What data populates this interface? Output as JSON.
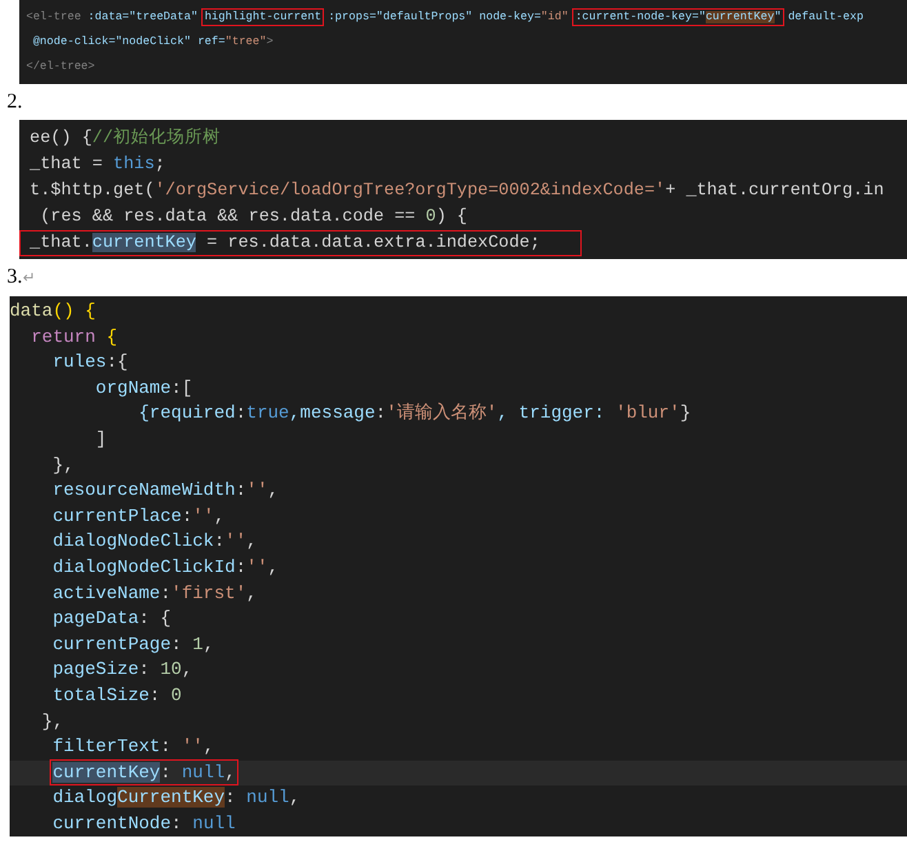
{
  "blocks": [
    {
      "lines": [
        {
          "tokens": [
            {
              "t": " <el-tree",
              "kind": "tag"
            },
            {
              "t": " :data=\"treeData\" ",
              "kind": "attr"
            },
            {
              "t": "highlight-current",
              "kind": "attr",
              "boxed": true
            },
            {
              "t": " :props=\"defaultProps\" node-key=",
              "kind": "attr"
            },
            {
              "t": "\"id\" ",
              "kind": "str"
            },
            {
              "t": ":current-node-key=\"",
              "kind": "attr",
              "boxed": true
            },
            {
              "t": "currentKey",
              "kind": "attr",
              "boxed": true,
              "match": true
            },
            {
              "t": "\"",
              "kind": "attr",
              "boxed": true
            },
            {
              "t": " default-exp",
              "kind": "attr"
            }
          ]
        },
        {
          "tokens": [
            {
              "t": "  @node-click=\"nodeClick\" ref=",
              "kind": "attr"
            },
            {
              "t": "\"tree\"",
              "kind": "str"
            },
            {
              "t": ">",
              "kind": "tag"
            }
          ]
        },
        {
          "tokens": [
            {
              "t": " </el-tree>",
              "kind": "tag"
            }
          ]
        }
      ]
    },
    {
      "label": "2.",
      "lines": [
        {
          "tokens": [
            {
              "t": " ee() {",
              "kind": "plain"
            },
            {
              "t": "//初始化场所树",
              "kind": "cmt"
            }
          ]
        },
        {
          "tokens": [
            {
              "t": " _that = ",
              "kind": "plain"
            },
            {
              "t": "this",
              "kind": "kw"
            },
            {
              "t": ";",
              "kind": "plain"
            }
          ]
        },
        {
          "tokens": [
            {
              "t": " t.$http.get(",
              "kind": "plain"
            },
            {
              "t": "'/orgService/loadOrgTree?orgType=0002&indexCode='",
              "kind": "str"
            },
            {
              "t": "+ _that.currentOrg.in",
              "kind": "plain"
            }
          ]
        },
        {
          "tokens": [
            {
              "t": "  (res && res.data && res.data.code == ",
              "kind": "plain"
            },
            {
              "t": "0",
              "kind": "num"
            },
            {
              "t": ") {",
              "kind": "plain"
            }
          ]
        },
        {
          "boxed": true,
          "tokens": [
            {
              "t": " _that.",
              "kind": "plain"
            },
            {
              "t": "currentKey",
              "kind": "prop",
              "selected": true
            },
            {
              "t": " = res.data.data.extra.indexCode;",
              "kind": "plain"
            }
          ]
        }
      ]
    },
    {
      "label": "3.",
      "mark": "↵",
      "lines": [
        {
          "tokens": [
            {
              "t": "data",
              "kind": "fn"
            },
            {
              "t": "() {",
              "kind": "punc"
            }
          ]
        },
        {
          "tokens": [
            {
              "t": "  return",
              "kind": "ctl"
            },
            {
              "t": " {",
              "kind": "punc"
            }
          ]
        },
        {
          "tokens": [
            {
              "t": "    rules",
              "kind": "prop"
            },
            {
              "t": ":{",
              "kind": "plain"
            }
          ]
        },
        {
          "tokens": [
            {
              "t": "        orgName",
              "kind": "prop"
            },
            {
              "t": ":[",
              "kind": "plain"
            }
          ]
        },
        {
          "tokens": [
            {
              "t": "            {required",
              "kind": "prop"
            },
            {
              "t": ":",
              "kind": "plain"
            },
            {
              "t": "true",
              "kind": "kw"
            },
            {
              "t": ",message",
              "kind": "prop"
            },
            {
              "t": ":",
              "kind": "plain"
            },
            {
              "t": "'请输入名称'",
              "kind": "str"
            },
            {
              "t": ", trigger: ",
              "kind": "prop"
            },
            {
              "t": "'blur'",
              "kind": "str"
            },
            {
              "t": "}",
              "kind": "plain"
            }
          ]
        },
        {
          "tokens": [
            {
              "t": "        ]",
              "kind": "plain"
            }
          ]
        },
        {
          "tokens": [
            {
              "t": "    },",
              "kind": "plain"
            }
          ]
        },
        {
          "tokens": [
            {
              "t": "    resourceNameWidth",
              "kind": "prop"
            },
            {
              "t": ":",
              "kind": "plain"
            },
            {
              "t": "''",
              "kind": "str"
            },
            {
              "t": ",",
              "kind": "plain"
            }
          ]
        },
        {
          "tokens": [
            {
              "t": "    currentPlace",
              "kind": "prop"
            },
            {
              "t": ":",
              "kind": "plain"
            },
            {
              "t": "''",
              "kind": "str"
            },
            {
              "t": ",",
              "kind": "plain"
            }
          ]
        },
        {
          "tokens": [
            {
              "t": "    dialogNodeClick",
              "kind": "prop"
            },
            {
              "t": ":",
              "kind": "plain"
            },
            {
              "t": "''",
              "kind": "str"
            },
            {
              "t": ",",
              "kind": "plain"
            }
          ]
        },
        {
          "tokens": [
            {
              "t": "    dialogNodeClickId",
              "kind": "prop"
            },
            {
              "t": ":",
              "kind": "plain"
            },
            {
              "t": "''",
              "kind": "str"
            },
            {
              "t": ",",
              "kind": "plain"
            }
          ]
        },
        {
          "tokens": [
            {
              "t": "    activeName",
              "kind": "prop"
            },
            {
              "t": ":",
              "kind": "plain"
            },
            {
              "t": "'first'",
              "kind": "str"
            },
            {
              "t": ",",
              "kind": "plain"
            }
          ]
        },
        {
          "tokens": [
            {
              "t": "    pageData",
              "kind": "prop"
            },
            {
              "t": ": {",
              "kind": "plain"
            }
          ]
        },
        {
          "tokens": [
            {
              "t": "    currentPage",
              "kind": "prop"
            },
            {
              "t": ": ",
              "kind": "plain"
            },
            {
              "t": "1",
              "kind": "num"
            },
            {
              "t": ",",
              "kind": "plain"
            }
          ]
        },
        {
          "tokens": [
            {
              "t": "    pageSize",
              "kind": "prop"
            },
            {
              "t": ": ",
              "kind": "plain"
            },
            {
              "t": "10",
              "kind": "num"
            },
            {
              "t": ",",
              "kind": "plain"
            }
          ]
        },
        {
          "tokens": [
            {
              "t": "    totalSize",
              "kind": "prop"
            },
            {
              "t": ": ",
              "kind": "plain"
            },
            {
              "t": "0",
              "kind": "num"
            }
          ]
        },
        {
          "tokens": [
            {
              "t": "   },",
              "kind": "plain"
            }
          ]
        },
        {
          "tokens": [
            {
              "t": "    filterText",
              "kind": "prop"
            },
            {
              "t": ": ",
              "kind": "plain"
            },
            {
              "t": "''",
              "kind": "str"
            },
            {
              "t": ",",
              "kind": "plain"
            }
          ]
        },
        {
          "current": true,
          "tokens": [
            {
              "t": "    currentKey",
              "kind": "prop",
              "selected": true,
              "boxed": true
            },
            {
              "t": ": ",
              "kind": "plain",
              "boxed": true
            },
            {
              "t": "null",
              "kind": "kw",
              "boxed": true
            },
            {
              "t": ",",
              "kind": "plain",
              "boxed": true
            }
          ]
        },
        {
          "tokens": [
            {
              "t": "    dialog",
              "kind": "prop"
            },
            {
              "t": "CurrentKey",
              "kind": "prop",
              "match": true
            },
            {
              "t": ": ",
              "kind": "plain"
            },
            {
              "t": "null",
              "kind": "kw"
            },
            {
              "t": ",",
              "kind": "plain"
            }
          ]
        },
        {
          "tokens": [
            {
              "t": "    currentNode",
              "kind": "prop"
            },
            {
              "t": ": ",
              "kind": "plain"
            },
            {
              "t": "null",
              "kind": "kw"
            }
          ]
        }
      ]
    }
  ]
}
